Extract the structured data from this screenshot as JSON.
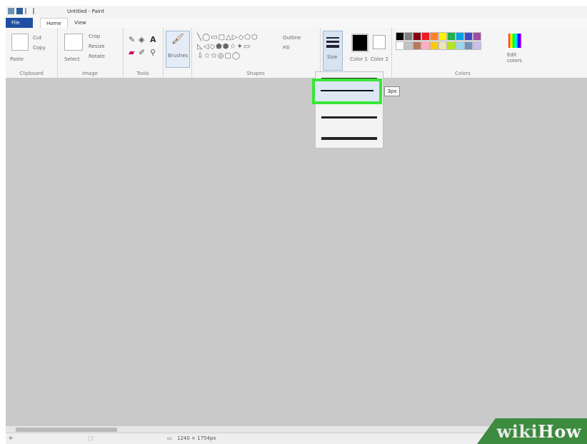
{
  "window": {
    "title": "Untitled - Paint"
  },
  "tabs": [
    {
      "label": "File"
    },
    {
      "label": "Home"
    },
    {
      "label": "View"
    }
  ],
  "ribbon": {
    "clipboard": {
      "label": "Clipboard",
      "paste": "Paste",
      "cut": "Cut",
      "copy": "Copy"
    },
    "image": {
      "label": "Image",
      "select": "Select",
      "crop": "Crop",
      "resize": "Resize",
      "rotate": "Rotate"
    },
    "tools": {
      "label": "Tools"
    },
    "brushes": {
      "label": "Brushes"
    },
    "shapes": {
      "label": "Shapes",
      "outline": "Outline",
      "fill": "Fill"
    },
    "size": {
      "label": "Size"
    },
    "color1": {
      "label": "Color 1"
    },
    "color2": {
      "label": "Color 2"
    },
    "colors": {
      "label": "Colors",
      "edit": "Edit colors",
      "palette": [
        "#000000",
        "#7f7f7f",
        "#880015",
        "#ed1c24",
        "#ff7f27",
        "#fff200",
        "#22b14c",
        "#00a2e8",
        "#3f48cc",
        "#a349a4",
        "#ffffff",
        "#c3c3c3",
        "#b97a57",
        "#ffaec9",
        "#ffc90e",
        "#efe4b0",
        "#b5e61d",
        "#99d9ea",
        "#7092be",
        "#c8bfe7"
      ]
    }
  },
  "size_menu": {
    "tooltip": "3px",
    "options": [
      {
        "stroke": 1
      },
      {
        "stroke": 2
      },
      {
        "stroke": 3
      },
      {
        "stroke": 4
      }
    ]
  },
  "status": {
    "dimensions": "1240 × 1754px"
  },
  "watermark": {
    "wiki": "wiki",
    "how": "How"
  },
  "colors": {
    "highlight": "#39e639",
    "file_tab": "#1e4fa1"
  }
}
